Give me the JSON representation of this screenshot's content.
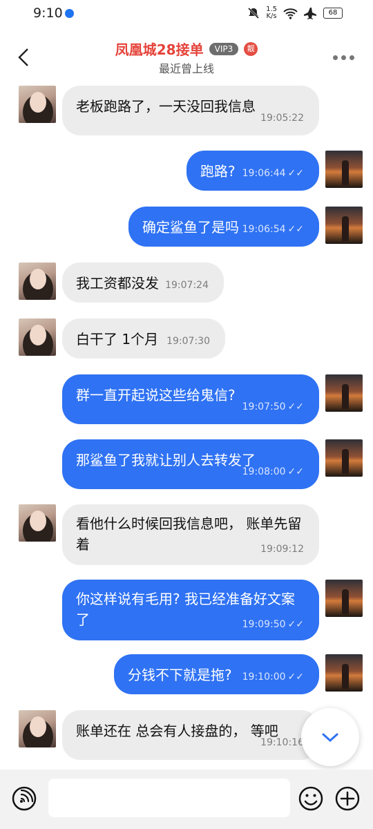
{
  "status_bar": {
    "time": "9:10",
    "network_speed": [
      "1.5",
      "K/s"
    ],
    "battery": "68"
  },
  "header": {
    "title": "凤凰城28接单",
    "vip_badge": "VIP3",
    "svip_badge": "靓",
    "subtitle": "最近曾上线"
  },
  "messages": [
    {
      "side": "incoming",
      "text": "老板跑路了，一天没回我信息",
      "time": "19:05:22"
    },
    {
      "side": "outgoing",
      "text": "跑路?",
      "time": "19:06:44"
    },
    {
      "side": "outgoing",
      "text": "确定鲨鱼了是吗",
      "time": "19:06:54"
    },
    {
      "side": "incoming",
      "text": "我工资都没发",
      "time": "19:07:24"
    },
    {
      "side": "incoming",
      "text": "白干了  1个月",
      "time": "19:07:30"
    },
    {
      "side": "outgoing",
      "text": "群一直开起说这些给鬼信?",
      "time": "19:07:50"
    },
    {
      "side": "outgoing",
      "text": "那鲨鱼了我就让别人去转发了",
      "time": "19:08:00"
    },
    {
      "side": "incoming",
      "text": "看他什么时候回我信息吧， 账单先留着",
      "time": "19:09:12"
    },
    {
      "side": "outgoing",
      "text": "你这样说有毛用? 我已经准备好文案了",
      "time": "19:09:50"
    },
    {
      "side": "outgoing",
      "text": "分钱不下就是拖?",
      "time": "19:10:00"
    },
    {
      "side": "incoming",
      "text": "账单还在 总会有人接盘的， 等吧",
      "time": "19:10:16"
    }
  ],
  "icons": {
    "read_receipt": "✓✓"
  },
  "colors": {
    "outgoing_bubble": "#2f72f3",
    "incoming_bubble": "#ececec",
    "title": "#e5433a"
  }
}
